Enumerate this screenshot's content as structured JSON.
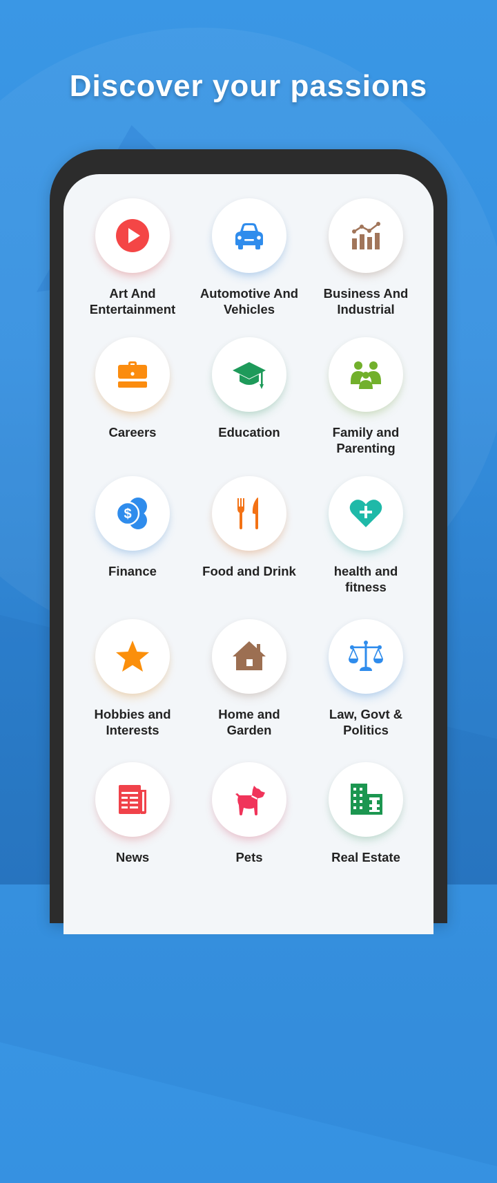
{
  "header": {
    "title": "Discover your passions"
  },
  "categories": [
    {
      "label": "Art And Entertainment",
      "line1": "Art And",
      "line2": "Entertainment",
      "icon": "play-icon",
      "color": "#f44646",
      "glow": "rgba(244,70,70,0.30)"
    },
    {
      "label": "Automotive And Vehicles",
      "line1": "Automotive And",
      "line2": "Vehicles",
      "icon": "car-icon",
      "color": "#2f8cec",
      "glow": "rgba(47,140,236,0.30)"
    },
    {
      "label": "Business And Industrial",
      "line1": "Business And",
      "line2": "Industrial",
      "icon": "chart-icon",
      "color": "#a1755a",
      "glow": "rgba(161,117,90,0.28)"
    },
    {
      "label": "Careers",
      "line1": "Careers",
      "line2": "",
      "icon": "briefcase-icon",
      "color": "#fb8c0f",
      "glow": "rgba(251,140,15,0.28)"
    },
    {
      "label": "Education",
      "line1": "Education",
      "line2": "",
      "icon": "graduation-cap-icon",
      "color": "#1e9a5a",
      "glow": "rgba(30,154,90,0.25)"
    },
    {
      "label": "Family and Parenting",
      "line1": "Family and",
      "line2": "Parenting",
      "icon": "family-icon",
      "color": "#72b02c",
      "glow": "rgba(114,176,44,0.25)"
    },
    {
      "label": "Finance",
      "line1": "Finance",
      "line2": "",
      "icon": "coins-icon",
      "color": "#2f8cec",
      "glow": "rgba(47,140,236,0.28)"
    },
    {
      "label": "Food and Drink",
      "line1": "Food and Drink",
      "line2": "",
      "icon": "fork-knife-icon",
      "color": "#f37215",
      "glow": "rgba(243,114,21,0.28)"
    },
    {
      "label": "health and fitness",
      "line1": "health and",
      "line2": "fitness",
      "icon": "heart-plus-icon",
      "color": "#1fb9a8",
      "glow": "rgba(31,185,168,0.25)"
    },
    {
      "label": "Hobbies and Interests",
      "line1": "Hobbies and",
      "line2": "Interests",
      "icon": "star-icon",
      "color": "#fb8f0b",
      "glow": "rgba(251,143,11,0.28)"
    },
    {
      "label": "Home and Garden",
      "line1": "Home and",
      "line2": "Garden",
      "icon": "house-icon",
      "color": "#9c6f52",
      "glow": "rgba(156,111,82,0.25)"
    },
    {
      "label": "Law, Govt & Politics",
      "line1": "Law, Govt &",
      "line2": "Politics",
      "icon": "scales-icon",
      "color": "#2f8cec",
      "glow": "rgba(47,140,236,0.30)"
    },
    {
      "label": "News",
      "line1": "News",
      "line2": "",
      "icon": "newspaper-icon",
      "color": "#f0424a",
      "glow": "rgba(240,66,74,0.25)"
    },
    {
      "label": "Pets",
      "line1": "Pets",
      "line2": "",
      "icon": "dog-icon",
      "color": "#f0345a",
      "glow": "rgba(240,52,90,0.25)"
    },
    {
      "label": "Real Estate",
      "line1": "Real Estate",
      "line2": "",
      "icon": "building-icon",
      "color": "#1c9650",
      "glow": "rgba(28,150,80,0.22)"
    }
  ]
}
